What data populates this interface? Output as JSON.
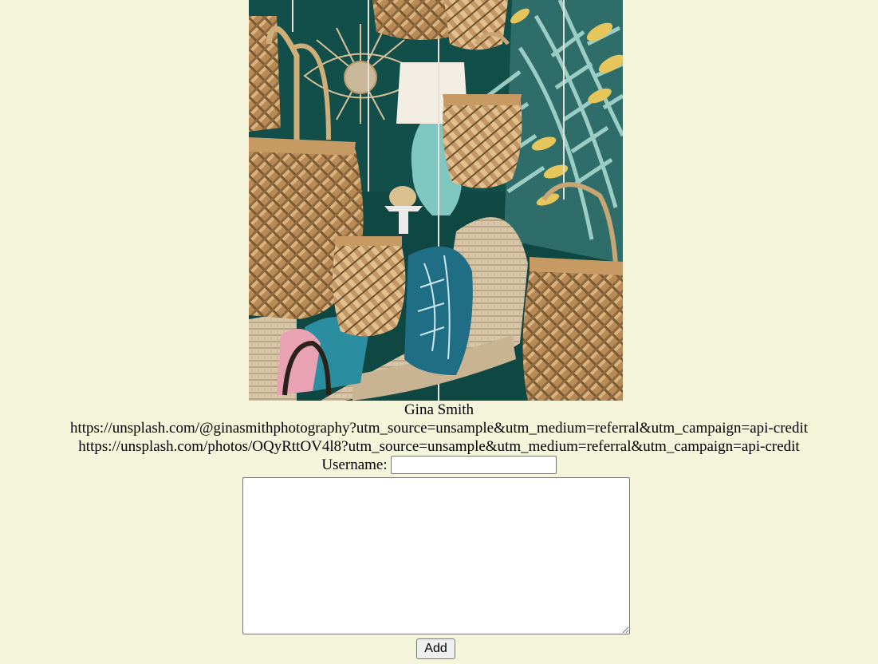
{
  "photo": {
    "alt": "Gina Smith"
  },
  "credit": {
    "name": "Gina Smith",
    "user_url": "https://unsplash.com/@ginasmithphotography?utm_source=unsample&utm_medium=referral&utm_campaign=api-credit",
    "photo_url": "https://unsplash.com/photos/OQyRttOV4l8?utm_source=unsample&utm_medium=referral&utm_campaign=api-credit"
  },
  "form": {
    "username_label": "Username:",
    "username_value": "",
    "body_value": "",
    "add_label": "Add"
  },
  "colors": {
    "background": "#f5f5dc",
    "wall": "#0f4742",
    "rattan": "#c9a06a",
    "leaf_yellow": "#e6c65a",
    "leaf_mint": "#a8d8cf"
  }
}
